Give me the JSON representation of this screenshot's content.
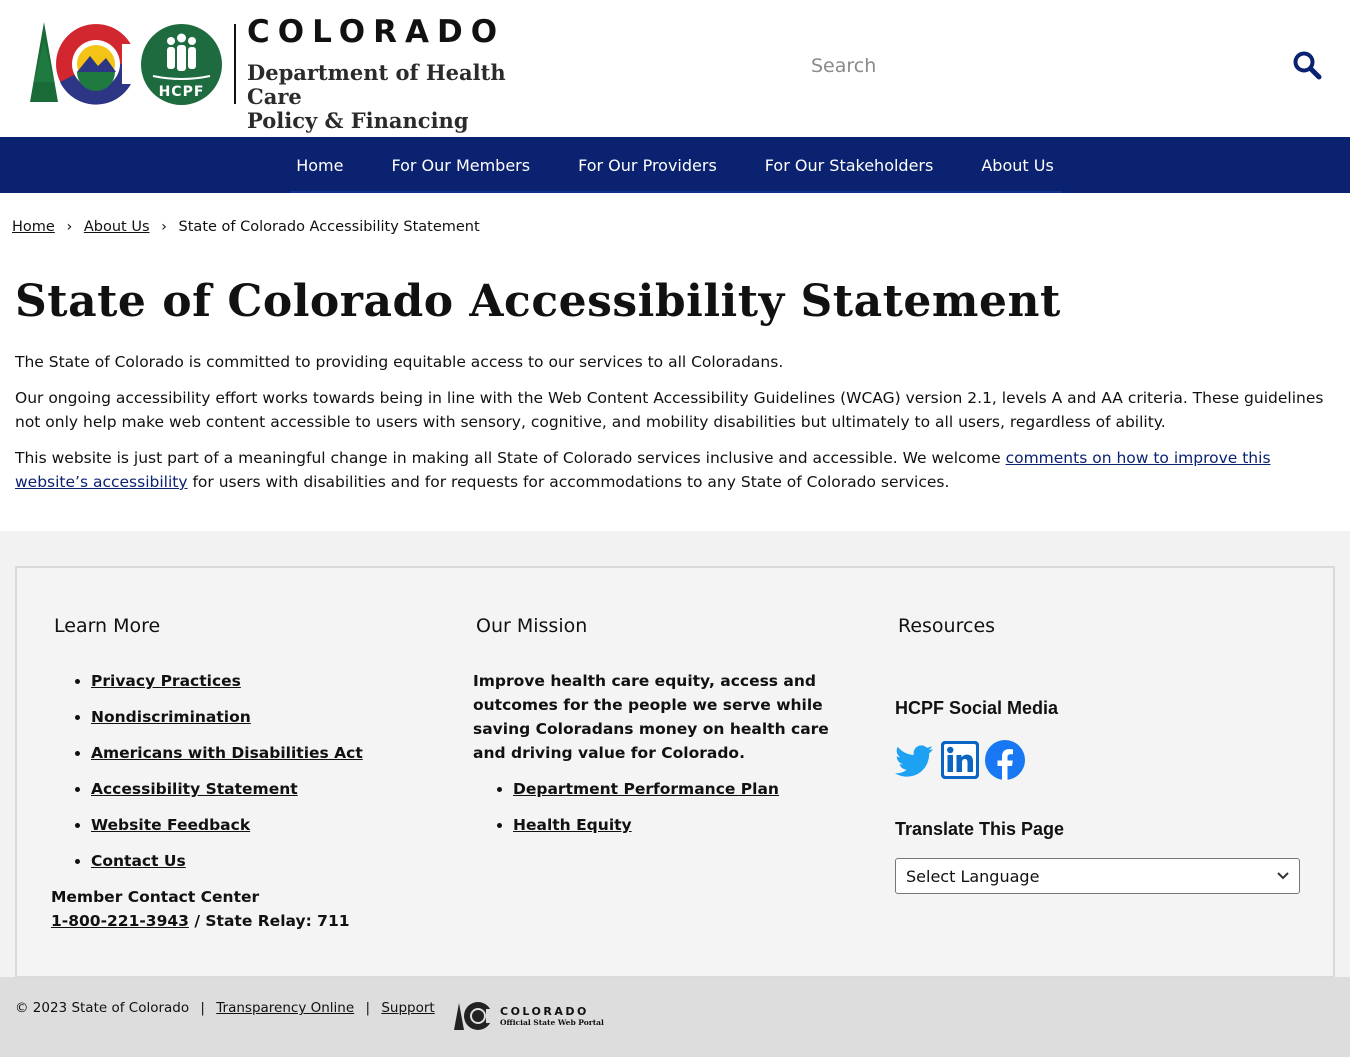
{
  "header": {
    "brand_state": "COLORADO",
    "dept_line1": "Department of Health Care",
    "dept_line2": "Policy & Financing",
    "hcpf_badge": "HCPF",
    "search_placeholder": "Search",
    "icons": [
      "colorado-logo",
      "hcpf-family-logo",
      "search-icon"
    ]
  },
  "nav": {
    "items": [
      {
        "label": "Home"
      },
      {
        "label": "For Our Members"
      },
      {
        "label": "For Our Providers"
      },
      {
        "label": "For Our Stakeholders"
      },
      {
        "label": "About Us"
      }
    ],
    "colors": {
      "background": "#0b2270"
    }
  },
  "breadcrumb": {
    "items": [
      {
        "label": "Home"
      },
      {
        "label": "About Us"
      },
      {
        "label": "State of Colorado Accessibility Statement"
      }
    ],
    "separator": "›"
  },
  "main": {
    "title": "State of Colorado Accessibility Statement",
    "p1": "The State of Colorado is committed to providing equitable access to our services to all Coloradans.",
    "p2": "Our ongoing accessibility effort works towards being in line with the Web Content Accessibility Guidelines (WCAG) version 2.1, levels A and AA criteria. These guidelines not only help make web content accessible to users with sensory, cognitive, and mobility disabilities but ultimately to all users, regardless of ability.",
    "p3_before": "This website is just part of a meaningful change in making all State of Colorado services inclusive and accessible. We welcome ",
    "p3_link": "comments on how to improve this website’s accessibility",
    "p3_after": " for users with disabilities and for requests for accommodations to any State of Colorado services."
  },
  "footer": {
    "learn_more": {
      "heading": "Learn More",
      "links": [
        {
          "label": "Privacy Practices"
        },
        {
          "label": "Nondiscrimination"
        },
        {
          "label": "Americans with Disabilities Act"
        },
        {
          "label": "Accessibility Statement"
        },
        {
          "label": "Website Feedback"
        },
        {
          "label": "Contact Us"
        }
      ],
      "contact_label": "Member Contact Center",
      "contact_phone": "1-800-221-3943",
      "contact_relay": " / State Relay: 711"
    },
    "mission": {
      "heading": "Our Mission",
      "text": "Improve health care equity, access and outcomes for the people we serve while saving Coloradans money on health care and driving value for Colorado.",
      "links": [
        {
          "label": "Department Performance Plan"
        },
        {
          "label": "Health Equity"
        }
      ]
    },
    "resources": {
      "heading": "Resources",
      "social_heading": "HCPF Social Media",
      "social_icons": [
        "twitter-icon",
        "linkedin-icon",
        "facebook-icon"
      ],
      "translate_heading": "Translate This Page",
      "language_selected": "Select Language"
    }
  },
  "bottom_bar": {
    "copyright": "© 2023 State of Colorado",
    "links": [
      {
        "label": "Transparency Online"
      },
      {
        "label": "Support"
      }
    ],
    "separator": "|",
    "portal_line1": "COLORADO",
    "portal_line2": "Official State Web Portal"
  }
}
